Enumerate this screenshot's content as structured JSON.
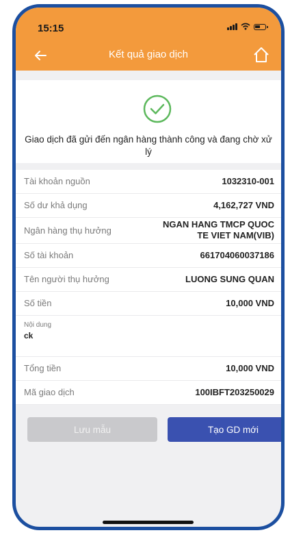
{
  "status_bar": {
    "time": "15:15"
  },
  "header": {
    "title": "Kết quả giao dịch",
    "color": "#f39a3c"
  },
  "result": {
    "message": "Giao dịch đã gửi đến ngân hàng thành công và đang chờ xử lý",
    "icon": "success-check-icon",
    "icon_color": "#5cb85c"
  },
  "details": {
    "source_account": {
      "label": "Tài khoản nguồn",
      "value": "1032310-001"
    },
    "available_balance": {
      "label": "Số dư khả dụng",
      "value": "4,162,727 VND"
    },
    "beneficiary_bank": {
      "label": "Ngân hàng thụ hưởng",
      "value_line1": "NGAN HANG TMCP QUOC",
      "value_line2": "TE VIET NAM(VIB)"
    },
    "account_number": {
      "label": "Số tài khoản",
      "value": "661704060037186"
    },
    "beneficiary_name": {
      "label": "Tên người thụ hưởng",
      "value": "LUONG SUNG QUAN"
    },
    "amount": {
      "label": "Số tiền",
      "value": "10,000 VND"
    },
    "content": {
      "label": "Nội dung",
      "value": "ck"
    },
    "total": {
      "label": "Tổng tiền",
      "value": "10,000 VND"
    },
    "transaction_id": {
      "label": "Mã giao dịch",
      "value": "100IBFT203250029"
    }
  },
  "actions": {
    "save_template": "Lưu mẫu",
    "new_transaction": "Tạo GD mới",
    "primary_color": "#3a51b0"
  }
}
